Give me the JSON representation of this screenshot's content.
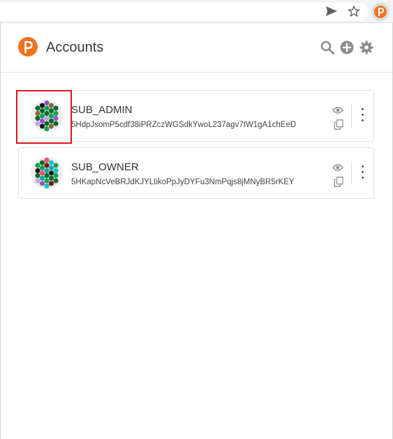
{
  "header": {
    "title": "Accounts",
    "icons": [
      "search-icon",
      "add-icon",
      "gear-icon"
    ]
  },
  "browser": {
    "icons": [
      "send-icon",
      "star-icon",
      "polkadot-extension-icon"
    ]
  },
  "accounts": [
    {
      "name": "SUB_ADMIN",
      "address": "5HdpJsomP5cdf38iPRZczWGSdkYwoL237agv7tW1gA1chEeD",
      "highlighted": true
    },
    {
      "name": "SUB_OWNER",
      "address": "5HKapNcVeBRJdKJYLtikoPpJyDYFu3NmPqjs8jMNyBR5rKEY",
      "highlighted": false
    }
  ],
  "colors": {
    "brand": "#f0731f",
    "highlight": "#e0141e"
  }
}
